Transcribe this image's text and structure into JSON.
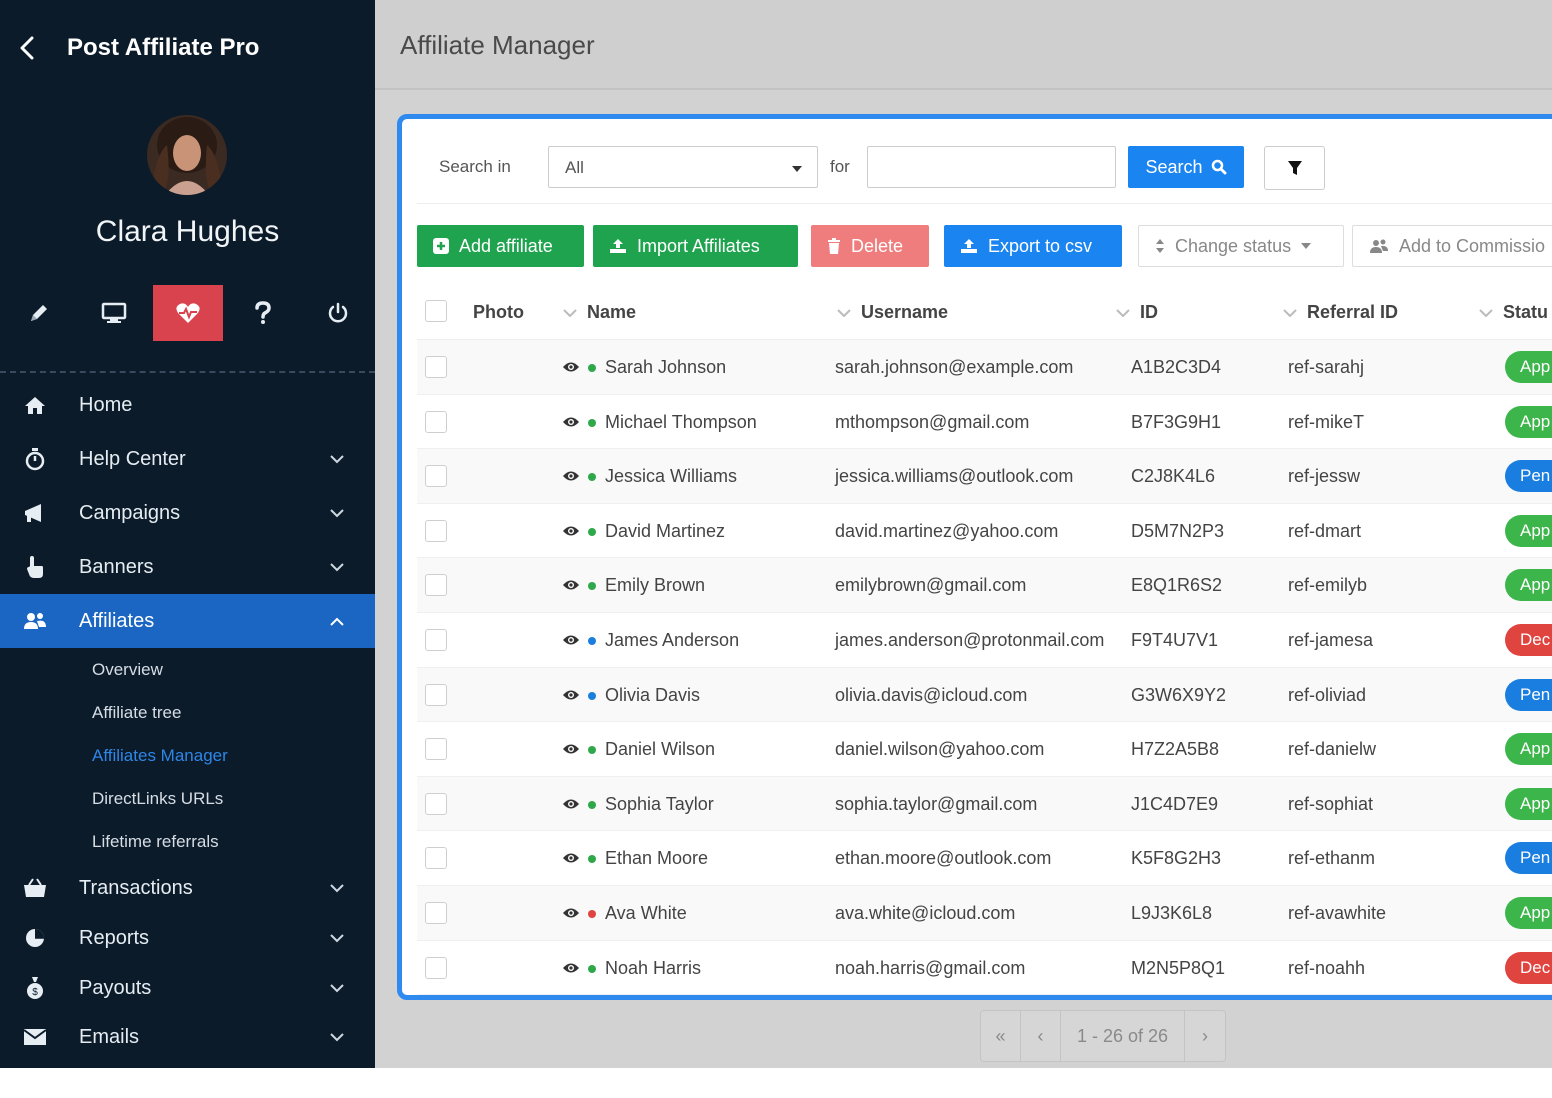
{
  "app": {
    "title": "Post Affiliate Pro"
  },
  "user": {
    "name": "Clara Hughes"
  },
  "quick_actions": [
    {
      "name": "edit-icon"
    },
    {
      "name": "monitor-icon"
    },
    {
      "name": "heartbeat-icon",
      "active": true
    },
    {
      "name": "help-icon"
    },
    {
      "name": "power-icon"
    }
  ],
  "nav": {
    "home": "Home",
    "help_center": "Help Center",
    "campaigns": "Campaigns",
    "banners": "Banners",
    "affiliates": "Affiliates",
    "affiliates_sub": {
      "overview": "Overview",
      "tree": "Affiliate tree",
      "manager": "Affiliates Manager",
      "directlinks": "DirectLinks URLs",
      "lifetime": "Lifetime referrals"
    },
    "transactions": "Transactions",
    "reports": "Reports",
    "payouts": "Payouts",
    "emails": "Emails"
  },
  "page": {
    "title": "Affiliate Manager"
  },
  "search": {
    "search_in_label": "Search in",
    "search_in_value": "All",
    "for_label": "for",
    "query": "",
    "button": "Search"
  },
  "actions": {
    "add": "Add affiliate",
    "import": "Import Affiliates",
    "delete": "Delete",
    "export": "Export to csv",
    "change_status": "Change status",
    "add_commission": "Add to Commissio"
  },
  "table": {
    "headers": {
      "photo": "Photo",
      "name": "Name",
      "username": "Username",
      "id": "ID",
      "referral_id": "Referral ID",
      "status": "Statu"
    },
    "rows": [
      {
        "name": "Sarah Johnson",
        "username": "sarah.johnson@example.com",
        "id": "A1B2C3D4",
        "ref": "ref-sarahj",
        "status": "App",
        "dot": "#2ea84a",
        "status_color": "#3cb54a"
      },
      {
        "name": "Michael Thompson",
        "username": "mthompson@gmail.com",
        "id": "B7F3G9H1",
        "ref": "ref-mikeT",
        "status": "App",
        "dot": "#2ea84a",
        "status_color": "#3cb54a"
      },
      {
        "name": "Jessica Williams",
        "username": "jessica.williams@outlook.com",
        "id": "C2J8K4L6",
        "ref": "ref-jessw",
        "status": "Pen",
        "dot": "#2ea84a",
        "status_color": "#1a7ee0"
      },
      {
        "name": "David Martinez",
        "username": "david.martinez@yahoo.com",
        "id": "D5M7N2P3",
        "ref": "ref-dmart",
        "status": "App",
        "dot": "#2ea84a",
        "status_color": "#3cb54a"
      },
      {
        "name": "Emily Brown",
        "username": "emilybrown@gmail.com",
        "id": "E8Q1R6S2",
        "ref": "ref-emilyb",
        "status": "App",
        "dot": "#2ea84a",
        "status_color": "#3cb54a"
      },
      {
        "name": "James Anderson",
        "username": "james.anderson@protonmail.com",
        "id": "F9T4U7V1",
        "ref": "ref-jamesa",
        "status": "Dec",
        "dot": "#1a7ee0",
        "status_color": "#e0443e"
      },
      {
        "name": "Olivia Davis",
        "username": "olivia.davis@icloud.com",
        "id": "G3W6X9Y2",
        "ref": "ref-oliviad",
        "status": "Pen",
        "dot": "#1a7ee0",
        "status_color": "#1a7ee0"
      },
      {
        "name": "Daniel Wilson",
        "username": "daniel.wilson@yahoo.com",
        "id": "H7Z2A5B8",
        "ref": "ref-danielw",
        "status": "App",
        "dot": "#2ea84a",
        "status_color": "#3cb54a"
      },
      {
        "name": "Sophia Taylor",
        "username": "sophia.taylor@gmail.com",
        "id": "J1C4D7E9",
        "ref": "ref-sophiat",
        "status": "App",
        "dot": "#2ea84a",
        "status_color": "#3cb54a"
      },
      {
        "name": "Ethan Moore",
        "username": "ethan.moore@outlook.com",
        "id": "K5F8G2H3",
        "ref": "ref-ethanm",
        "status": "Pen",
        "dot": "#2ea84a",
        "status_color": "#1a7ee0"
      },
      {
        "name": "Ava White",
        "username": "ava.white@icloud.com",
        "id": "L9J3K6L8",
        "ref": "ref-avawhite",
        "status": "App",
        "dot": "#e0443e",
        "status_color": "#3cb54a"
      },
      {
        "name": "Noah Harris",
        "username": "noah.harris@gmail.com",
        "id": "M2N5P8Q1",
        "ref": "ref-noahh",
        "status": "Dec",
        "dot": "#2ea84a",
        "status_color": "#e0443e"
      }
    ]
  },
  "pagination": {
    "first": "«",
    "prev": "‹",
    "range": "1 - 26 of 26",
    "next": "›"
  }
}
